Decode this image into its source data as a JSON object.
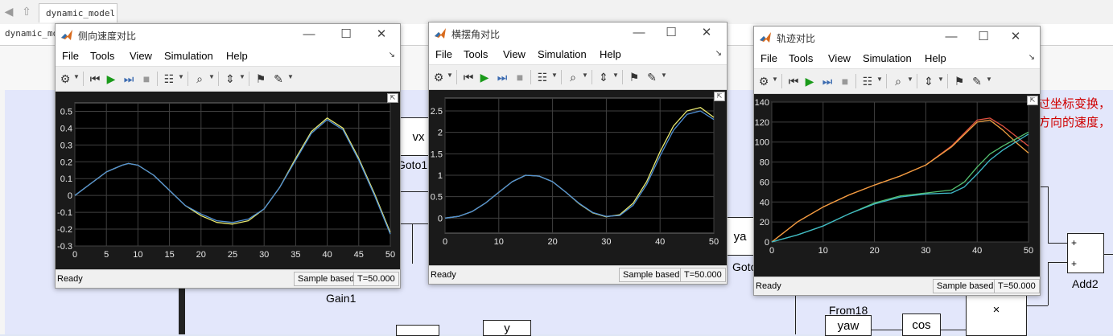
{
  "colors": {
    "plot_bg": "#000000",
    "blue": "#4f8fd6",
    "yellow": "#e8e870",
    "orange": "#f0a040",
    "red": "#e05040",
    "green": "#55c070",
    "cyan": "#3fb8c8",
    "grid": "#404040",
    "text_red": "#d00000"
  },
  "background": {
    "tab": "dynamic_model",
    "breadcrumb": "dynamic_model",
    "blocks": {
      "vx_goto": "vx",
      "goto1_label": "Goto1",
      "ya_goto": "ya",
      "goto_partial_label": "Goto",
      "gain1_label": "Gain1",
      "from18_label": "From18",
      "yaw_from": "yaw",
      "cos_block": "cos",
      "add2_label": "Add2",
      "add_plus1": "+",
      "add_plus2": "+",
      "mult_symbol": "×",
      "from_partial": "y",
      "annotation_line1": "过坐标变换，",
      "annotation_line2": "方向的速度，"
    }
  },
  "menu": [
    "File",
    "Tools",
    "View",
    "Simulation",
    "Help"
  ],
  "status": {
    "ready": "Ready",
    "sample": "Sample based",
    "time": "T=50.000"
  },
  "windows": [
    {
      "title": "侧向速度对比"
    },
    {
      "title": "横摆角对比"
    },
    {
      "title": "轨迹对比"
    }
  ],
  "chart_data": [
    {
      "type": "line",
      "title": "侧向速度对比",
      "xlim": [
        0,
        50
      ],
      "ylim": [
        -0.3,
        0.55
      ],
      "xticks": [
        0,
        5,
        10,
        15,
        20,
        25,
        30,
        35,
        40,
        45,
        50
      ],
      "yticks": [
        -0.3,
        -0.2,
        -0.1,
        0,
        0.1,
        0.2,
        0.3,
        0.4,
        0.5
      ],
      "ytick_labels": [
        "-0.3",
        "-0.2",
        "-0.1",
        "0",
        "0.1",
        "0.2",
        "0.3",
        "0.4",
        "0.5"
      ],
      "grid": true,
      "series": [
        {
          "color": "yellow",
          "x": [
            0,
            2.5,
            5,
            7.5,
            8.5,
            10,
            12.5,
            15,
            17.5,
            20,
            22.5,
            25,
            27.5,
            30,
            32.5,
            35,
            37.5,
            40,
            42.5,
            45,
            47.5,
            50
          ],
          "y": [
            0,
            0.07,
            0.14,
            0.18,
            0.19,
            0.18,
            0.12,
            0.03,
            -0.06,
            -0.12,
            -0.16,
            -0.17,
            -0.15,
            -0.08,
            0.05,
            0.22,
            0.38,
            0.46,
            0.4,
            0.22,
            0.01,
            -0.22
          ]
        },
        {
          "color": "blue",
          "x": [
            0,
            2.5,
            5,
            7.5,
            8.5,
            10,
            12.5,
            15,
            17.5,
            20,
            22.5,
            25,
            27.5,
            30,
            32.5,
            35,
            37.5,
            40,
            42.5,
            45,
            47.5,
            50
          ],
          "y": [
            0,
            0.07,
            0.14,
            0.18,
            0.19,
            0.18,
            0.12,
            0.03,
            -0.06,
            -0.11,
            -0.15,
            -0.16,
            -0.14,
            -0.08,
            0.05,
            0.21,
            0.37,
            0.45,
            0.39,
            0.21,
            0.0,
            -0.23
          ]
        }
      ]
    },
    {
      "type": "line",
      "title": "横摆角对比",
      "xlim": [
        0,
        50
      ],
      "ylim": [
        -0.35,
        2.8
      ],
      "xticks": [
        0,
        10,
        20,
        30,
        40,
        50
      ],
      "yticks": [
        0,
        0.5,
        1,
        1.5,
        2,
        2.5
      ],
      "ytick_labels": [
        "0",
        "0.5",
        "1",
        "1.5",
        "2",
        "2.5"
      ],
      "grid": true,
      "series": [
        {
          "color": "yellow",
          "x": [
            0,
            2.5,
            5,
            7.5,
            10,
            12.5,
            15,
            17.5,
            20,
            22.5,
            25,
            27.5,
            30,
            32.5,
            35,
            37.5,
            40,
            42.5,
            45,
            47.5,
            50
          ],
          "y": [
            0,
            0.04,
            0.15,
            0.35,
            0.6,
            0.85,
            1.0,
            0.98,
            0.85,
            0.6,
            0.33,
            0.12,
            0.03,
            0.08,
            0.35,
            0.85,
            1.55,
            2.15,
            2.5,
            2.58,
            2.35
          ]
        },
        {
          "color": "blue",
          "x": [
            0,
            2.5,
            5,
            7.5,
            10,
            12.5,
            15,
            17.5,
            20,
            22.5,
            25,
            27.5,
            30,
            32.5,
            35,
            37.5,
            40,
            42.5,
            45,
            47.5,
            50
          ],
          "y": [
            0,
            0.04,
            0.15,
            0.35,
            0.6,
            0.85,
            1.0,
            0.98,
            0.85,
            0.6,
            0.34,
            0.13,
            0.04,
            0.06,
            0.3,
            0.78,
            1.45,
            2.05,
            2.42,
            2.5,
            2.3
          ]
        }
      ]
    },
    {
      "type": "line",
      "title": "轨迹对比",
      "xlim": [
        0,
        50
      ],
      "ylim": [
        0,
        140
      ],
      "xticks": [
        0,
        10,
        20,
        30,
        40,
        50
      ],
      "yticks": [
        0,
        20,
        40,
        60,
        80,
        100,
        120,
        140
      ],
      "ytick_labels": [
        "0",
        "20",
        "40",
        "60",
        "80",
        "100",
        "120",
        "140"
      ],
      "grid": true,
      "series": [
        {
          "color": "red",
          "x": [
            0,
            5,
            10,
            15,
            20,
            25,
            30,
            35,
            40,
            42.5,
            45,
            47.5,
            50
          ],
          "y": [
            0,
            20,
            35,
            47,
            57,
            66,
            77,
            96,
            122,
            124,
            116,
            106,
            96
          ]
        },
        {
          "color": "orange",
          "x": [
            0,
            5,
            10,
            15,
            20,
            25,
            30,
            35,
            40,
            42.5,
            45,
            47.5,
            50
          ],
          "y": [
            0,
            20,
            35,
            47,
            57,
            66,
            77,
            95,
            120,
            122,
            112,
            100,
            89
          ]
        },
        {
          "color": "green",
          "x": [
            0,
            5,
            10,
            15,
            20,
            25,
            30,
            35,
            37.5,
            40,
            42.5,
            45,
            47.5,
            50
          ],
          "y": [
            0,
            7,
            16,
            28,
            39,
            46,
            49,
            52,
            60,
            75,
            88,
            96,
            103,
            110
          ]
        },
        {
          "color": "cyan",
          "x": [
            0,
            5,
            10,
            15,
            20,
            25,
            30,
            35,
            37.5,
            40,
            42.5,
            45,
            47.5,
            50
          ],
          "y": [
            0,
            7,
            16,
            28,
            38,
            45,
            48,
            49,
            55,
            68,
            82,
            92,
            100,
            108
          ]
        }
      ]
    }
  ]
}
